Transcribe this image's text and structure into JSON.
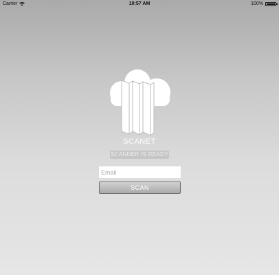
{
  "status_bar": {
    "carrier": "Carrier",
    "time": "10:57 AM",
    "battery": "100%"
  },
  "app": {
    "title": "SCANET",
    "status_badge": "SCANNER IS READY"
  },
  "form": {
    "email_placeholder": "Email",
    "email_value": "",
    "scan_label": "SCAN"
  },
  "icons": {
    "wifi": "wifi-icon",
    "battery": "battery-icon",
    "logo": "cloud-documents-logo"
  },
  "colors": {
    "background_top": "#aaaaaa",
    "background_bottom": "#e6e6e6",
    "badge_bg": "#c6c6c6",
    "button_top": "#d2d2d2",
    "button_bottom": "#a9a9a9"
  }
}
